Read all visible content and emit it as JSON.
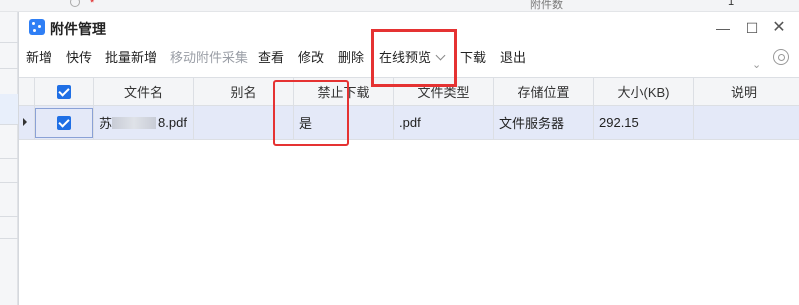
{
  "background": {
    "label": "附件数",
    "value": "1"
  },
  "dialog": {
    "title": "附件管理",
    "window_controls": [
      "minimize-icon",
      "maximize-icon",
      "close-icon"
    ]
  },
  "toolbar": {
    "items": [
      "新增",
      "快传",
      "批量新增",
      "移动附件采集",
      "查看",
      "修改",
      "删除",
      "在线预览",
      "下载",
      "退出"
    ],
    "disabled_item": "移动附件采集",
    "dropdown_item": "在线预览"
  },
  "table": {
    "columns": [
      "文件名",
      "别名",
      "禁止下载",
      "文件类型",
      "存储位置",
      "大小(KB)",
      "说明"
    ],
    "rows": [
      {
        "checked": true,
        "filename_suffix": "8.pdf",
        "filename_prefix": "苏",
        "alias": "",
        "no_download": "是",
        "file_type": ".pdf",
        "storage": "文件服务器",
        "size": "292.15",
        "note": ""
      }
    ]
  },
  "colors": {
    "accent": "#1f6fe5",
    "highlight": "#e53232",
    "selected_row": "#e4e9f8"
  }
}
